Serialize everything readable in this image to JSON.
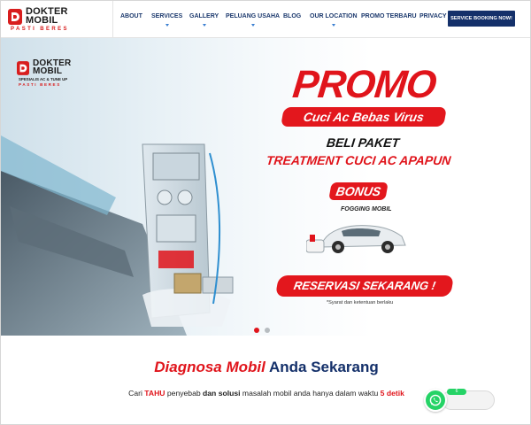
{
  "brand": {
    "name_line1": "DOKTER",
    "name_line2": "MOBIL",
    "tagline": "PASTI BERES",
    "hero_subtitle": "SPESIALIS AC & TUNE UP",
    "hero_tagline": "PASTI BERES",
    "accent_red": "#e0141b",
    "navy": "#14306a"
  },
  "nav": {
    "items": [
      {
        "label": "ABOUT",
        "has_dropdown": false
      },
      {
        "label": "SERVICES",
        "has_dropdown": true
      },
      {
        "label": "GALLERY",
        "has_dropdown": true
      },
      {
        "label": "PELUANG USAHA",
        "has_dropdown": true
      },
      {
        "label": "BLOG",
        "has_dropdown": false
      },
      {
        "label": "OUR LOCATION",
        "has_dropdown": true
      },
      {
        "label": "PROMO TERBARU",
        "has_dropdown": false
      },
      {
        "label": "PRIVACY P",
        "has_dropdown": false
      }
    ],
    "cta_label": "SERVICE BOOKING NOW!"
  },
  "hero": {
    "promo": "PROMO",
    "subtitle": "Cuci Ac Bebas Virus",
    "beli": "BELI PAKET",
    "treatment": "TREATMENT CUCI AC APAPUN",
    "bonus": "BONUS",
    "fogging": "FOGGING MOBIL",
    "reserve": "RESERVASI SEKARANG !",
    "syarat": "*Syarat dan ketentuan berlaku",
    "slides": 2,
    "active_slide": 1
  },
  "diagnosa": {
    "title_red": "Diagnosa Mobil",
    "title_navy": " Anda Sekarang",
    "desc_1": "Cari ",
    "desc_hl1": "TAHU",
    "desc_2": " penyebab ",
    "desc_hl2": "dan solusi",
    "desc_3": " masalah mobil anda hanya dalam waktu ",
    "desc_hl3": "5 detik"
  },
  "whatsapp": {
    "badge": "6"
  }
}
